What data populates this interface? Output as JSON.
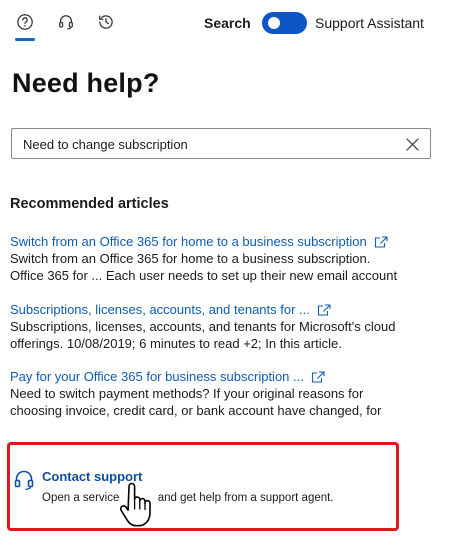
{
  "header": {
    "tabs": [
      {
        "icon": "help-circle-icon",
        "active": true
      },
      {
        "icon": "headset-icon",
        "active": false
      },
      {
        "icon": "history-icon",
        "active": false
      }
    ],
    "search_label": "Search",
    "support_assistant_label": "Support Assistant",
    "support_assistant_enabled": true
  },
  "main": {
    "title": "Need help?",
    "search": {
      "value": "Need to change subscription",
      "clear_icon": "close-icon"
    },
    "recommended_heading": "Recommended articles",
    "articles": [
      {
        "title": "Switch from an Office 365 for home to a business subscription",
        "desc_lines": [
          "Switch from an Office 365 for home to a business subscription.",
          "Office 365 for ... Each user needs to set up their new email account"
        ]
      },
      {
        "title": "Subscriptions, licenses, accounts, and tenants for ...",
        "desc_lines": [
          "Subscriptions, licenses, accounts, and tenants for Microsoft's cloud",
          "offerings. 10/08/2019; 6 minutes to read +2; In this article."
        ]
      },
      {
        "title": "Pay for your Office 365 for business subscription ...",
        "desc_lines": [
          "Need to switch payment methods? If your original reasons for",
          "choosing invoice, credit card, or bank account have changed, for"
        ]
      }
    ],
    "contact": {
      "title": "Contact support",
      "desc_before": "Open a service",
      "desc_after": "and get help from a support agent.",
      "highlight_color": "#e0191b"
    }
  },
  "colors": {
    "accent": "#0f6cbd",
    "link": "#0f5cb0",
    "toggle": "#0f55c6"
  }
}
